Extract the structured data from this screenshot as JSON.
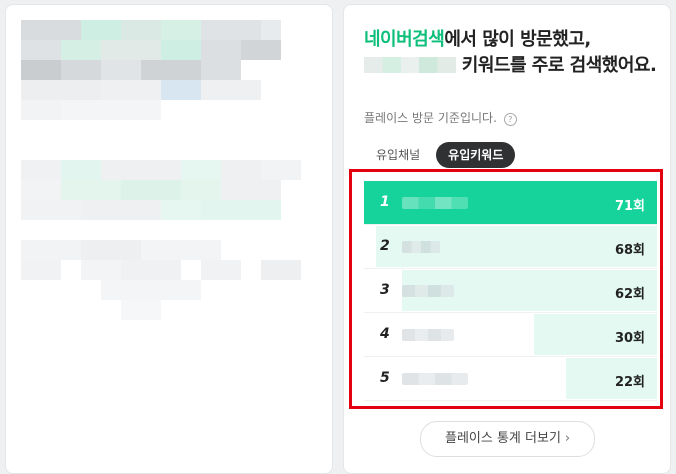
{
  "headline": {
    "accent": "네이버검색",
    "part1": "에서 많이 방문했고,",
    "part2": " 키워드를 주로 검색했어요."
  },
  "subnote": "플레이스 방문 기준입니다.",
  "help_icon": "question-circle-icon",
  "tabs": [
    {
      "label": "유입채널",
      "active": false
    },
    {
      "label": "유입키워드",
      "active": true
    }
  ],
  "keywords": [
    {
      "rank": "1",
      "count": "71회",
      "share": 1.0
    },
    {
      "rank": "2",
      "count": "68회",
      "share": 0.96
    },
    {
      "rank": "3",
      "count": "62회",
      "share": 0.87
    },
    {
      "rank": "4",
      "count": "30회",
      "share": 0.42
    },
    {
      "rank": "5",
      "count": "22회",
      "share": 0.31
    }
  ],
  "more_button": {
    "label": "플레이스 통계 더보기",
    "icon": "chevron-right-icon"
  },
  "colors": {
    "accent": "#0dbf7a",
    "top_bar": "#15d39a",
    "bar": "#e3f9f1",
    "highlight": "#e3000f"
  }
}
